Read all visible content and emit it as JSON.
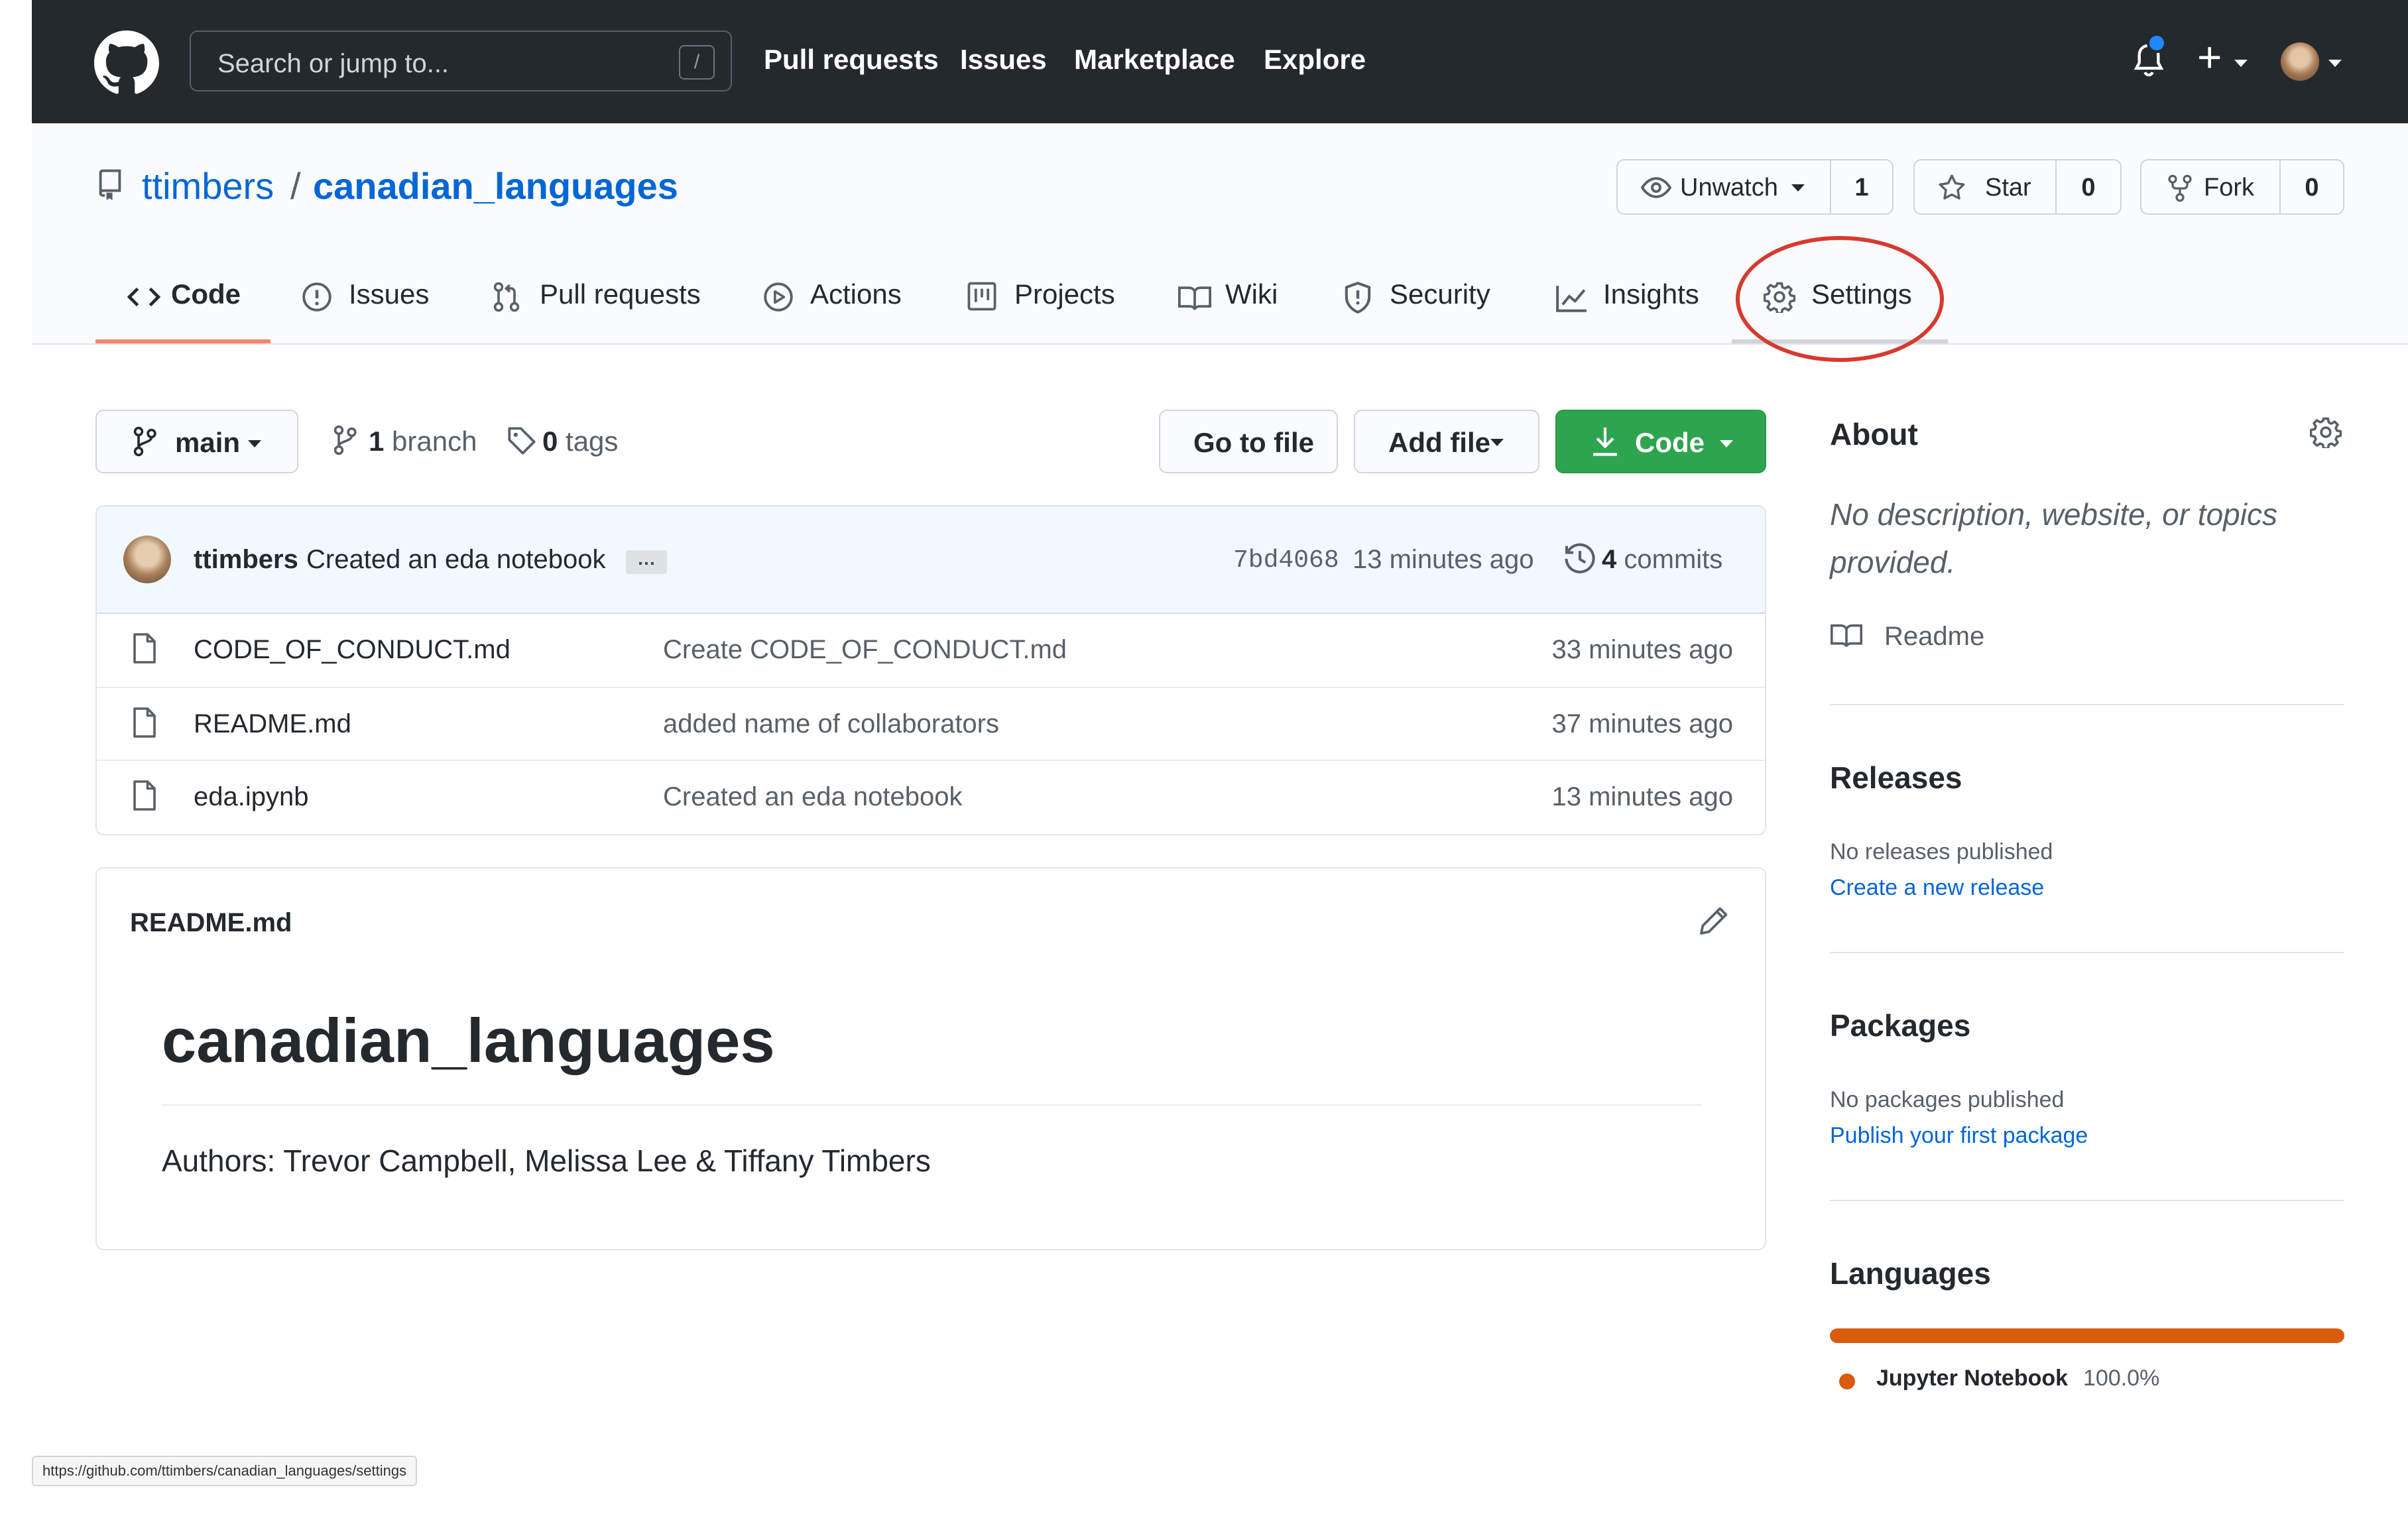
{
  "header": {
    "search_placeholder": "Search or jump to...",
    "slash_key": "/",
    "nav": [
      "Pull requests",
      "Issues",
      "Marketplace",
      "Explore"
    ],
    "plus": "+",
    "icons": {
      "logo": "github-mark",
      "notifications": "bell-icon",
      "create": "plus-icon",
      "avatar": "user-avatar"
    }
  },
  "repo": {
    "owner": "ttimbers",
    "separator": "/",
    "name": "canadian_languages",
    "watch_label": "Unwatch",
    "watch_count": "1",
    "star_label": "Star",
    "star_count": "0",
    "fork_label": "Fork",
    "fork_count": "0"
  },
  "tabs": [
    "Code",
    "Issues",
    "Pull requests",
    "Actions",
    "Projects",
    "Wiki",
    "Security",
    "Insights",
    "Settings"
  ],
  "branch_bar": {
    "branch": "main",
    "branch_count": "1",
    "branch_word": "branch",
    "tag_count": "0",
    "tag_word": "tags",
    "goto_file": "Go to file",
    "add_file": "Add file",
    "code": "Code"
  },
  "commit": {
    "author": "ttimbers",
    "message": "Created an eda notebook",
    "ellipsis": "…",
    "sha": "7bd4068",
    "time": "13 minutes ago",
    "commit_count": "4",
    "commit_word": "commits"
  },
  "files": [
    {
      "name": "CODE_OF_CONDUCT.md",
      "message": "Create CODE_OF_CONDUCT.md",
      "age": "33 minutes ago"
    },
    {
      "name": "README.md",
      "message": "added name of collaborators",
      "age": "37 minutes ago"
    },
    {
      "name": "eda.ipynb",
      "message": "Created an eda notebook",
      "age": "13 minutes ago"
    }
  ],
  "readme": {
    "filename": "README.md",
    "heading": "canadian_languages",
    "authors": "Authors: Trevor Campbell, Melissa Lee & Tiffany Timbers"
  },
  "sidebar": {
    "about_title": "About",
    "about_desc": "No description, website, or topics provided.",
    "readme_link": "Readme",
    "releases_title": "Releases",
    "releases_text": "No releases published",
    "releases_link": "Create a new release",
    "packages_title": "Packages",
    "packages_text": "No packages published",
    "packages_link": "Publish your first package",
    "languages_title": "Languages",
    "language_name": "Jupyter Notebook",
    "language_pct": "100.0%",
    "language_color": "#da5b0b"
  },
  "status_url": "https://github.com/ttimbers/canadian_languages/settings",
  "colors": {
    "header_bg": "#24292e",
    "link": "#0366d6",
    "code_button": "#2ea44f",
    "active_tab": "#f9826c",
    "highlight_circle": "#d73a2e"
  }
}
